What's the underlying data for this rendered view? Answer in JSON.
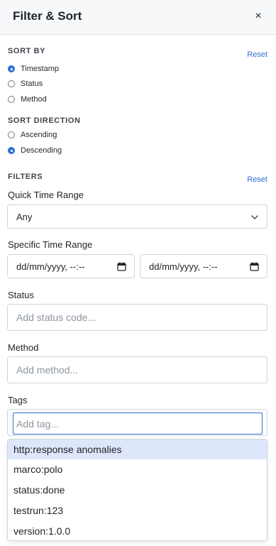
{
  "header": {
    "title": "Filter & Sort",
    "close_glyph": "×"
  },
  "sort_by": {
    "label": "SORT BY",
    "reset_label": "Reset",
    "options": [
      {
        "label": "Timestamp",
        "checked": true
      },
      {
        "label": "Status",
        "checked": false
      },
      {
        "label": "Method",
        "checked": false
      }
    ]
  },
  "sort_direction": {
    "label": "SORT DIRECTION",
    "options": [
      {
        "label": "Ascending",
        "checked": false
      },
      {
        "label": "Descending",
        "checked": true
      }
    ]
  },
  "filters": {
    "label": "FILTERS",
    "reset_label": "Reset",
    "quick_time_range": {
      "label": "Quick Time Range",
      "value": "Any"
    },
    "specific_time_range": {
      "label": "Specific Time Range",
      "start_placeholder": "dd/mm/yyyy, --:--",
      "end_placeholder": "dd/mm/yyyy, --:--"
    },
    "status": {
      "label": "Status",
      "placeholder": "Add status code..."
    },
    "method": {
      "label": "Method",
      "placeholder": "Add method..."
    },
    "tags": {
      "label": "Tags",
      "placeholder": "Add tag...",
      "suggestions": [
        "http:response anomalies",
        "marco:polo",
        "status:done",
        "testrun:123",
        "version:1.0.0"
      ],
      "highlighted_index": 0
    }
  },
  "colors": {
    "accent": "#2f6fd6",
    "header_bg": "#f6f8fa",
    "highlight_bg": "#dde6fb"
  }
}
